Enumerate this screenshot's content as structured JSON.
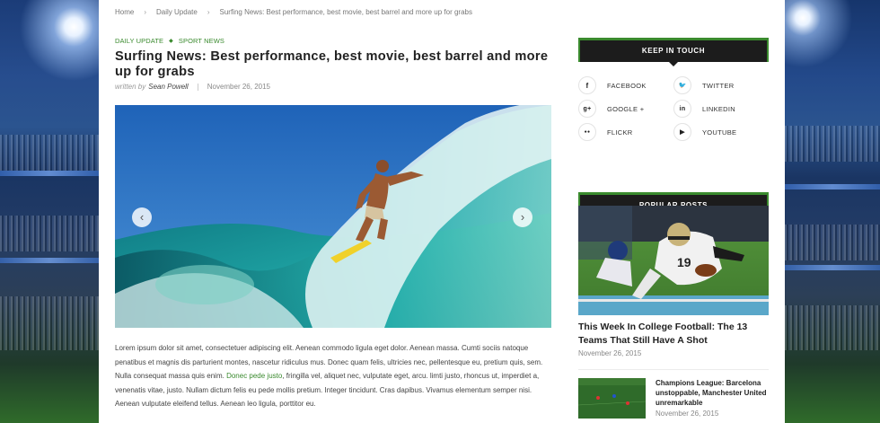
{
  "breadcrumb": {
    "home": "Home",
    "category": "Daily Update",
    "current": "Surfing News: Best performance, best movie, best barrel and more up for grabs"
  },
  "post": {
    "categories": [
      "DAILY UPDATE",
      "SPORT NEWS"
    ],
    "title": "Surfing News: Best performance, best movie, best barrel and more up for grabs",
    "written_by": "written by",
    "author": "Sean Powell",
    "date": "November 26, 2015",
    "body_parts": [
      "Lorem ipsum dolor sit amet, consectetuer adipiscing elit. Aenean commodo ligula eget dolor. Aenean massa. Cumti sociis natoque penatibus et magnis dis parturient montes, nascetur ridiculus mus. Donec quam felis, ultricies nec, pellentesque eu, pretium quis, sem. Nulla consequat massa quis enim. ",
      "Donec pede justo",
      ", fringilla vel, aliquet nec, vulputate eget, arcu. limti justo, rhoncus ut, imperdiet a, venenatis vitae, justo. Nullam dictum felis eu pede mollis pretium. Integer tincidunt. Cras dapibus. Vivamus elementum semper nisi. Aenean vulputate eleifend tellus. Aenean leo ligula, porttitor eu."
    ],
    "slider_prev": "‹",
    "slider_next": "›"
  },
  "sidebar": {
    "keep_in_touch": {
      "heading": "KEEP IN TOUCH",
      "items": [
        {
          "label": "FACEBOOK",
          "icon": "facebook-icon",
          "glyph": "f"
        },
        {
          "label": "TWITTER",
          "icon": "twitter-icon",
          "glyph": "🐦"
        },
        {
          "label": "GOOGLE +",
          "icon": "google-plus-icon",
          "glyph": "g+"
        },
        {
          "label": "LINKEDIN",
          "icon": "linkedin-icon",
          "glyph": "in"
        },
        {
          "label": "FLICKR",
          "icon": "flickr-icon",
          "glyph": "●●"
        },
        {
          "label": "YOUTUBE",
          "icon": "youtube-icon",
          "glyph": "▶"
        }
      ]
    },
    "popular_posts": {
      "heading": "POPULAR POSTS",
      "featured": {
        "title": "This Week In College Football: The 13 Teams That Still Have A Shot",
        "date": "November 26, 2015"
      },
      "list": [
        {
          "title": "Champions League: Barcelona unstoppable, Manchester United unremarkable",
          "date": "November 26, 2015"
        }
      ]
    }
  },
  "colors": {
    "accent": "#3a8a2e",
    "widget_bg": "#1c1c1c",
    "text": "#222222"
  }
}
